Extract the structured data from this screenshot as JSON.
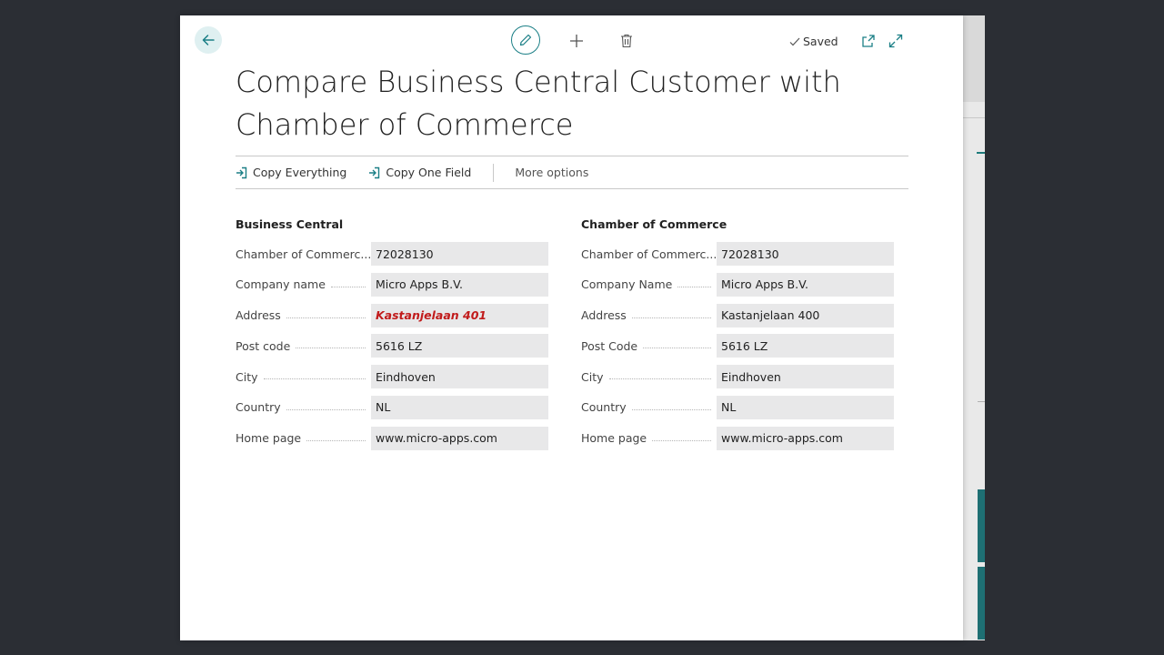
{
  "header": {
    "saved_label": "Saved",
    "title": "Compare Business Central Customer with Chamber of Commerce"
  },
  "actions": {
    "copy_everything": "Copy Everything",
    "copy_one_field": "Copy One Field",
    "more_options": "More options"
  },
  "business_central": {
    "title": "Business Central",
    "fields": [
      {
        "label": "Chamber of Commerc...",
        "value": "72028130"
      },
      {
        "label": "Company name",
        "value": "Micro Apps B.V."
      },
      {
        "label": "Address",
        "value": "Kastanjelaan 401"
      },
      {
        "label": "Post code",
        "value": "5616 LZ"
      },
      {
        "label": "City",
        "value": "Eindhoven"
      },
      {
        "label": "Country",
        "value": "NL"
      },
      {
        "label": "Home page",
        "value": "www.micro-apps.com"
      }
    ]
  },
  "chamber_of_commerce": {
    "title": "Chamber of Commerce",
    "fields": [
      {
        "label": "Chamber of Commerc...",
        "value": "72028130"
      },
      {
        "label": "Company Name",
        "value": "Micro Apps B.V."
      },
      {
        "label": "Address",
        "value": "Kastanjelaan 400"
      },
      {
        "label": "Post Code",
        "value": "5616 LZ"
      },
      {
        "label": "City",
        "value": "Eindhoven"
      },
      {
        "label": "Country",
        "value": "NL"
      },
      {
        "label": "Home page",
        "value": "www.micro-apps.com"
      }
    ]
  },
  "colors": {
    "accent": "#1b7f86",
    "difference": "#c11b1b",
    "field_bg": "#e8e8e9"
  },
  "icons": {
    "back": "arrow-left-icon",
    "edit": "pencil-icon",
    "add": "plus-icon",
    "delete": "trash-icon",
    "saved": "checkmark-icon",
    "popout": "open-in-new-window-icon",
    "expand": "expand-icon",
    "copy": "sign-in-arrow-icon"
  }
}
